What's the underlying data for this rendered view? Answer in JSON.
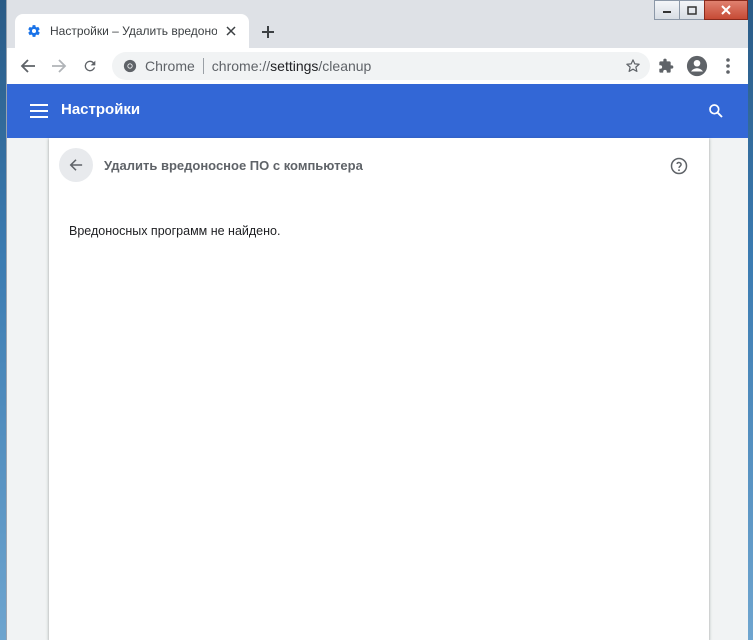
{
  "tab": {
    "title": "Настройки – Удалить вредонос",
    "favicon": "gear-icon"
  },
  "toolbar": {
    "site_label": "Chrome",
    "url_prefix": "chrome://",
    "url_host": "settings",
    "url_path": "/cleanup"
  },
  "header": {
    "title": "Настройки"
  },
  "subpage": {
    "title": "Удалить вредоносное ПО с компьютера",
    "status": "Вредоносных программ не найдено."
  },
  "colors": {
    "accent": "#3367d6",
    "tab_strip": "#dee1e6"
  }
}
